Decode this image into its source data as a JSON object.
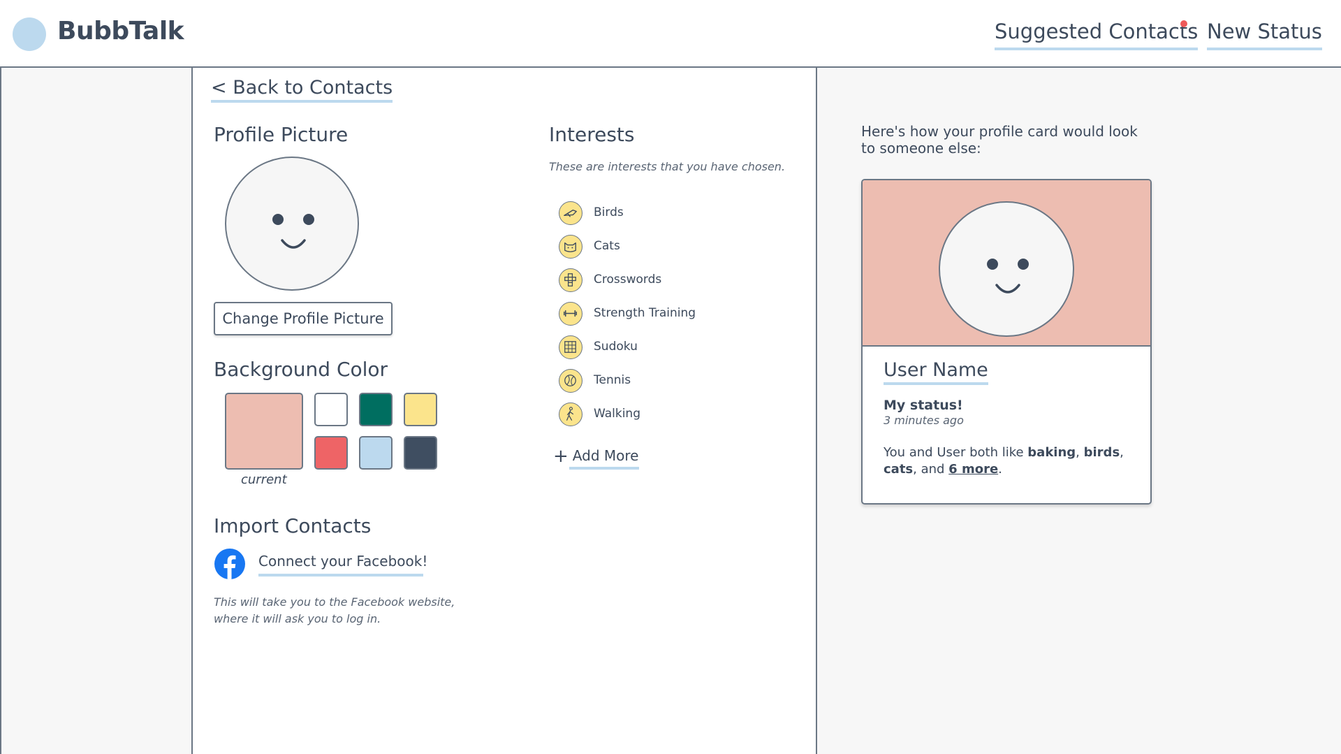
{
  "app": {
    "name": "BubbTalk"
  },
  "nav": {
    "suggested_contacts": "Suggested Contacts",
    "new_status": "New Status"
  },
  "back_link": "< Back to Contacts",
  "profile_picture": {
    "title": "Profile Picture",
    "change_button": "Change Profile Picture"
  },
  "background_color": {
    "title": "Background Color",
    "current_label": "current",
    "current_color": "#edbdb1",
    "options": [
      "#ffffff",
      "#006e60",
      "#fbe48c",
      "#ee6466",
      "#bcd9ee",
      "#3f4e61"
    ]
  },
  "import_contacts": {
    "title": "Import Contacts",
    "facebook_link": "Connect your Facebook!",
    "note": "This will take you to the Facebook website, where it will ask you to log in."
  },
  "interests": {
    "title": "Interests",
    "subtitle": "These are interests that you have chosen.",
    "items": [
      {
        "label": "Birds",
        "icon": "bird-icon"
      },
      {
        "label": "Cats",
        "icon": "cat-icon"
      },
      {
        "label": "Crosswords",
        "icon": "crossword-icon"
      },
      {
        "label": "Strength Training",
        "icon": "dumbbell-icon"
      },
      {
        "label": "Sudoku",
        "icon": "sudoku-grid-icon"
      },
      {
        "label": "Tennis",
        "icon": "tennis-ball-icon"
      },
      {
        "label": "Walking",
        "icon": "walking-person-icon"
      }
    ],
    "add_more": "Add More"
  },
  "preview": {
    "intro": "Here's how your profile card would look to someone else:",
    "user_name": "User Name",
    "status": "My status!",
    "time": "3 minutes ago",
    "likes_prefix": "You and User both like ",
    "like_1": "baking",
    "sep_1": ", ",
    "like_2": "birds",
    "sep_2": ", ",
    "like_3": "cats",
    "sep_3": ", and ",
    "more_link": "6 more",
    "likes_suffix": "."
  },
  "colors": {
    "accent_underline": "#bcd9ee",
    "text": "#3d4a5c",
    "notification": "#ef5a5a",
    "facebook": "#1877f2",
    "interest_icon_bg": "#fbe48c"
  }
}
